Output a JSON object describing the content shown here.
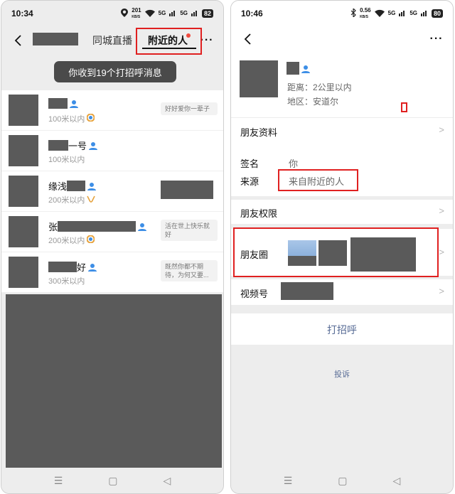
{
  "left": {
    "status": {
      "time": "10:34",
      "speed_value": "201",
      "speed_unit": "KB/S",
      "net1": "5G",
      "net2": "5G",
      "battery": "82"
    },
    "tabs": {
      "city_live": "同城直播",
      "nearby": "附近的人"
    },
    "toast": "你收到19个打招呼消息",
    "items": [
      {
        "name_suffix": "",
        "distance": "100米以内",
        "badge": "colorful",
        "greeting": "好好爱你一辈子"
      },
      {
        "name_suffix": "一号",
        "distance": "100米以内",
        "badge": "",
        "greeting": ""
      },
      {
        "name_prefix": "缘浅",
        "distance": "200米以内",
        "badge": "gold",
        "greeting": ""
      },
      {
        "name_prefix": "张",
        "distance": "200米以内",
        "badge": "colorful",
        "greeting": "活在世上快乐就好"
      },
      {
        "name_suffix": "好",
        "distance": "300米以内",
        "badge": "",
        "greeting": "既然你都不期待，为何又要..."
      }
    ]
  },
  "right": {
    "status": {
      "time": "10:46",
      "speed_value": "0.56",
      "speed_unit": "KB/S",
      "net1": "5G",
      "net2": "5G",
      "battery": "80"
    },
    "profile": {
      "distance": "距离：2公里以内",
      "region": "地区：安道尔"
    },
    "rows": {
      "friend_info": "朋友资料",
      "signature_label": "签名",
      "signature_value": "你",
      "source_label": "来源",
      "source_value": "来自附近的人",
      "permissions": "朋友权限",
      "moments": "朋友圈",
      "channels": "视频号"
    },
    "greet_button": "打招呼",
    "report": "投诉"
  },
  "colors": {
    "accent_blue": "#576b95",
    "highlight_red": "#e02020",
    "redaction_gray": "#5a5a5a"
  }
}
